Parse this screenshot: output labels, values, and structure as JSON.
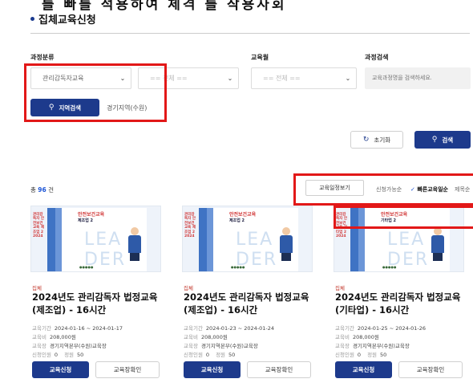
{
  "top_text": "를 빠를 적용하여 체격 를 작용사회",
  "section_title": "집체교육신청",
  "filters": {
    "course_category_label": "과정분류",
    "month_label": "교육월",
    "search_label": "과정검색",
    "category_value": "관리감독자교육",
    "sub_value": "== 전체 ==",
    "month_value": "== 전체 ==",
    "search_placeholder": "교육과정명을 검색하세요."
  },
  "region": {
    "search_button": "지역검색",
    "tab_label": "경기지역(수원)"
  },
  "actions": {
    "reset": "초기화",
    "search": "검색"
  },
  "results": {
    "count_prefix": "총 ",
    "count": "96",
    "count_suffix": " 건",
    "schedule_button": "교육일정보기",
    "sort_available": "신청가능순",
    "sort_fast": "빠른교육일순",
    "sort_title": "제목순"
  },
  "cards": [
    {
      "tag": "집체",
      "title": "2024년도 관리감독자 법정교육(제조업) - 16시간",
      "period_label": "교육기간",
      "period": "2024-01-16 ~ 2024-01-17",
      "fee_label": "교육비",
      "fee": "208,000원",
      "place_label": "교육장",
      "place": "경기지역본부(수원)교육장",
      "applicants_label": "신청인원",
      "applicants": "0",
      "capacity_label": "정원",
      "capacity": "50",
      "apply_button": "교육신청",
      "confirm_button": "교육장확인",
      "book_title": "안전보건교육",
      "book_sub": "제조업 2",
      "side_title": "관리감독자 안전보건교육 제조업 2",
      "side_year": "2024"
    },
    {
      "tag": "집체",
      "title": "2024년도 관리감독자 법정교육(제조업) - 16시간",
      "period_label": "교육기간",
      "period": "2024-01-23 ~ 2024-01-24",
      "fee_label": "교육비",
      "fee": "208,000원",
      "place_label": "교육장",
      "place": "경기지역본부(수원)교육장",
      "applicants_label": "신청인원",
      "applicants": "0",
      "capacity_label": "정원",
      "capacity": "50",
      "apply_button": "교육신청",
      "confirm_button": "교육장확인",
      "book_title": "안전보건교육",
      "book_sub": "제조업 2",
      "side_title": "관리감독자 안전보건교육 제조업 2",
      "side_year": "2024"
    },
    {
      "tag": "집체",
      "title": "2024년도 관리감독자 법정교육(기타업) - 16시간",
      "period_label": "교육기간",
      "period": "2024-01-25 ~ 2024-01-26",
      "fee_label": "교육비",
      "fee": "208,000원",
      "place_label": "교육장",
      "place": "경기지역본부(수원)교육장",
      "applicants_label": "신청인원",
      "applicants": "0",
      "capacity_label": "정원",
      "capacity": "50",
      "apply_button": "교육신청",
      "confirm_button": "교육장확인",
      "book_title": "안전보건교육",
      "book_sub": "기타업 2",
      "side_title": "관리감독자 안전보건교육 기타업 2",
      "side_year": "2024"
    }
  ],
  "colors": {
    "navy": "#1d3a8c",
    "highlight_red": "#e21818",
    "count_blue": "#1d55d6",
    "tag_red": "#c2352a"
  }
}
